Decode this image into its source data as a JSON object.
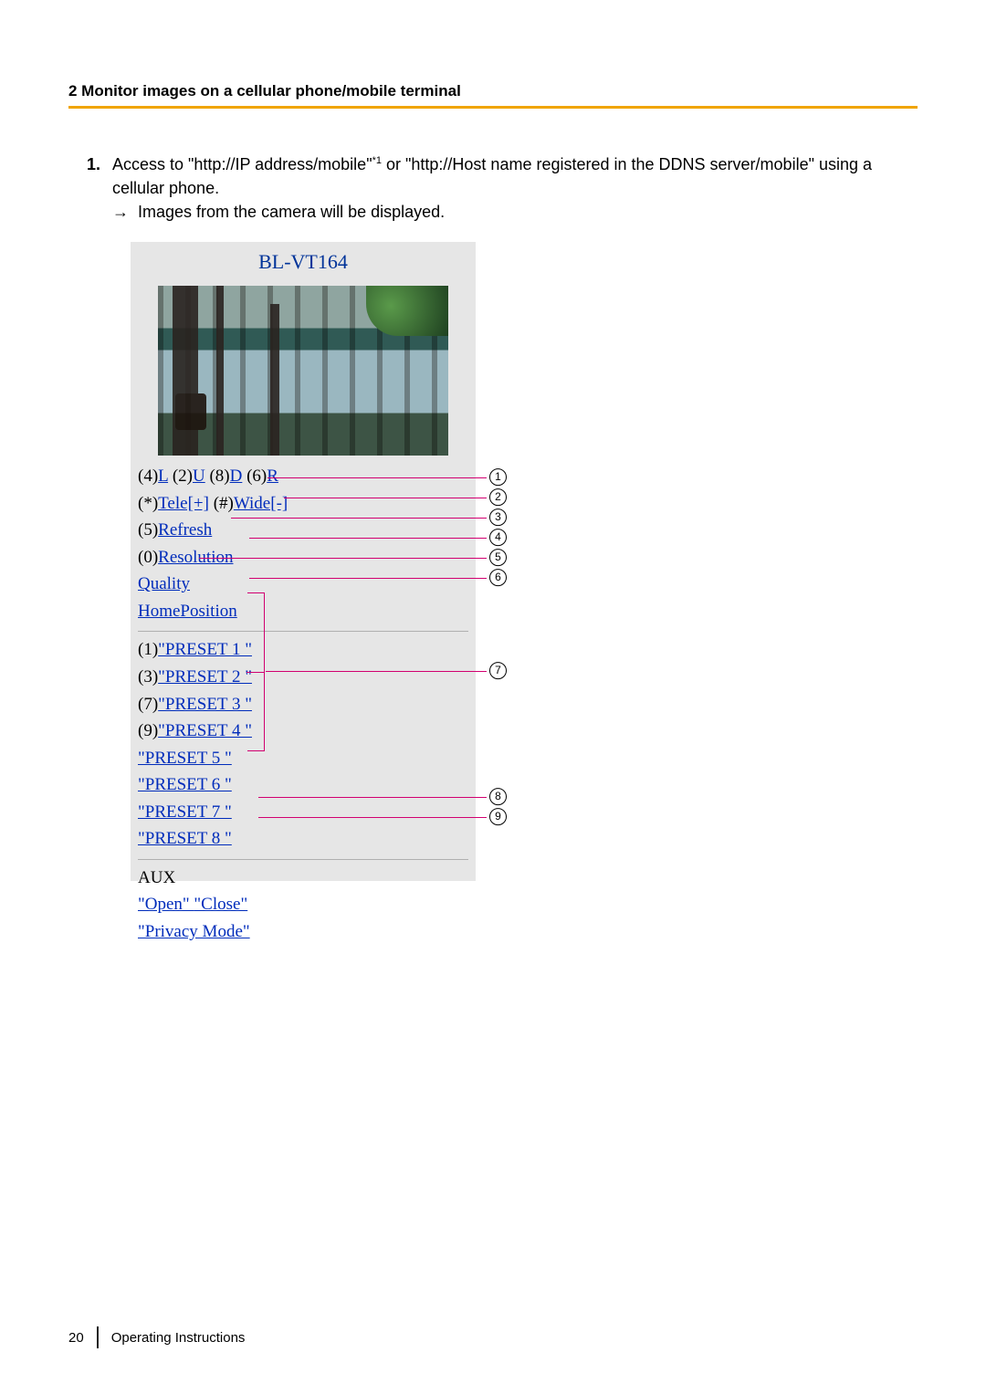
{
  "header": {
    "section_title": "2 Monitor images on a cellular phone/mobile terminal"
  },
  "steps": {
    "num": "1.",
    "text_before_footnote": "Access to \"http://IP address/mobile\"",
    "footnote_marker": "*1",
    "text_after_footnote": " or \"http://Host name registered in the DDNS server/mobile\" using a cellular phone.",
    "arrow": "→",
    "sub_text": "Images from the camera will be displayed."
  },
  "mobile": {
    "title": "BL-VT164",
    "line1": {
      "k4": "(4)",
      "L": "L",
      "k2": " (2)",
      "U": "U",
      "k8": " (8)",
      "D": "D",
      "k6": " (6)",
      "R": "R"
    },
    "line2": {
      "star": "(*)",
      "tele": "Tele[+]",
      "hash": " (#)",
      "wide": "Wide[-]"
    },
    "line3": {
      "k5": "(5)",
      "refresh": "Refresh"
    },
    "line4": {
      "k0": "(0)",
      "resolution": "Resolution"
    },
    "quality": "Quality",
    "home": "HomePosition",
    "presets": [
      {
        "key": "(1)",
        "label": "\"PRESET 1 \""
      },
      {
        "key": "(3)",
        "label": "\"PRESET 2 \""
      },
      {
        "key": "(7)",
        "label": "\"PRESET 3 \""
      },
      {
        "key": "(9)",
        "label": "\"PRESET 4 \""
      },
      {
        "key": "",
        "label": "\"PRESET 5 \""
      },
      {
        "key": "",
        "label": "\"PRESET 6 \""
      },
      {
        "key": "",
        "label": "\"PRESET 7 \""
      },
      {
        "key": "",
        "label": "\"PRESET 8 \""
      }
    ],
    "aux_label": "AUX",
    "open": " \"Open\" ",
    "close": " \"Close\" ",
    "privacy": " \"Privacy Mode\" "
  },
  "callouts": [
    "1",
    "2",
    "3",
    "4",
    "5",
    "6",
    "7",
    "8",
    "9"
  ],
  "footer": {
    "page_number": "20",
    "doc_title": "Operating Instructions"
  }
}
